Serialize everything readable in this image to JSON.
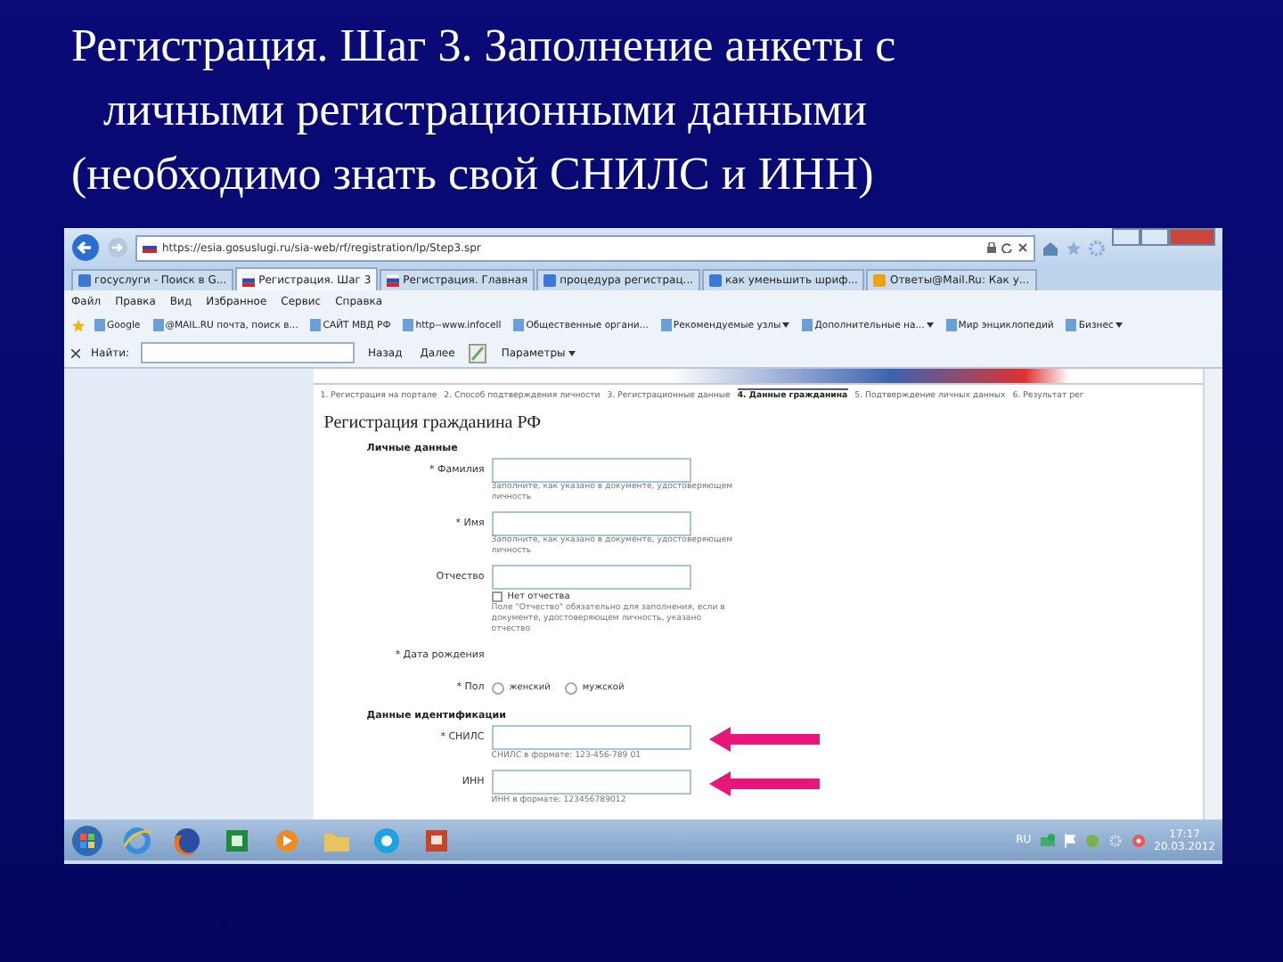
{
  "slide_title": {
    "lines": [
      "Регистрация. Шаг 3. Заполнение анкеты с",
      "личными регистрационными данными",
      "(необходимо знать свой СНИЛС  и ИНН)"
    ]
  },
  "browser": {
    "address": "https://esia.gosuslugi.ru/sia-web/rf/registration/lp/Step3.spr",
    "tabs": [
      {
        "label": "госуслуги - Поиск в G...",
        "selected": false,
        "kind": "search"
      },
      {
        "label": "Регистрация. Шаг 3",
        "selected": true,
        "kind": "page"
      },
      {
        "label": "Регистрация. Главная",
        "selected": false,
        "kind": "page"
      },
      {
        "label": "процедура регистрац...",
        "selected": false,
        "kind": "search"
      },
      {
        "label": "как уменьшить шриф...",
        "selected": false,
        "kind": "search"
      },
      {
        "label": "Ответы@Mail.Ru: Как у...",
        "selected": false,
        "kind": "mail"
      }
    ],
    "menu": [
      "Файл",
      "Правка",
      "Вид",
      "Избранное",
      "Сервис",
      "Справка"
    ],
    "favorites": [
      {
        "label": "Google",
        "dropdown": false
      },
      {
        "label": "@MAIL.RU почта, поиск в...",
        "dropdown": false
      },
      {
        "label": "САЙТ МВД РФ",
        "dropdown": false
      },
      {
        "label": "http--www.infocell",
        "dropdown": false
      },
      {
        "label": "Общественные органи...",
        "dropdown": false
      },
      {
        "label": "Рекомендуемые узлы",
        "dropdown": true
      },
      {
        "label": "Дополнительные на...",
        "dropdown": true
      },
      {
        "label": "Мир энциклопедий",
        "dropdown": false
      },
      {
        "label": "Бизнес",
        "dropdown": true
      }
    ],
    "find_bar": {
      "label": "Найти:",
      "buttons": [
        "Назад",
        "Далее"
      ],
      "options": "Параметры"
    }
  },
  "page": {
    "steps": [
      {
        "label": "1. Регистрация на портале",
        "selected": false
      },
      {
        "label": "2. Способ подтверждения личности",
        "selected": false
      },
      {
        "label": "3. Регистрационные данные",
        "selected": false
      },
      {
        "label": "4. Данные гражданина",
        "selected": true
      },
      {
        "label": "5. Подтверждение личных данных",
        "selected": false
      },
      {
        "label": "6. Результат рег",
        "selected": false
      }
    ],
    "heading": "Регистрация гражданина РФ",
    "sections": [
      {
        "title": "Личные данные",
        "fields": [
          {
            "kind": "text",
            "label": "* Фамилия",
            "hint": "Заполните, как указано в документе, удостоверяющем личность",
            "highlighted": false
          },
          {
            "kind": "text",
            "label": "* Имя",
            "hint": "Заполните, как указано в документе, удостоверяющем личность",
            "highlighted": false
          },
          {
            "kind": "text",
            "label": "Отчество",
            "highlighted": false,
            "checkbox": {
              "label": "Нет отчества",
              "checked": false,
              "note": "Поле \"Отчество\" обязательно для заполнения, если в документе, удостоверяющем личность, указано отчество"
            }
          },
          {
            "kind": "date",
            "label": "* Дата рождения"
          },
          {
            "kind": "radio",
            "label": "* Пол",
            "options": [
              {
                "label": "женский",
                "selected": false
              },
              {
                "label": "мужской",
                "selected": false
              }
            ]
          }
        ]
      },
      {
        "title": "Данные идентификации",
        "fields": [
          {
            "kind": "text",
            "label": "* СНИЛС",
            "hint": "СНИЛС в формате: 123-456-789 01",
            "highlighted": true
          },
          {
            "kind": "text",
            "label": "ИНН",
            "hint": "ИНН в формате: 123456789012",
            "highlighted": true
          }
        ]
      }
    ]
  },
  "taskbar": {
    "language": "RU",
    "time": "17:17",
    "date": "20.03.2012"
  }
}
